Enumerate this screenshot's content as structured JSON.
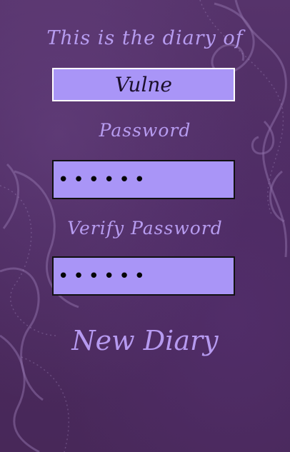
{
  "diary": {
    "owner_label": "This is the diary of",
    "owner_name": "Vulne",
    "password_label": "Password",
    "password_value": "••••••",
    "verify_label": "Verify Password",
    "verify_value": "••••••",
    "submit_label": "New Diary"
  }
}
